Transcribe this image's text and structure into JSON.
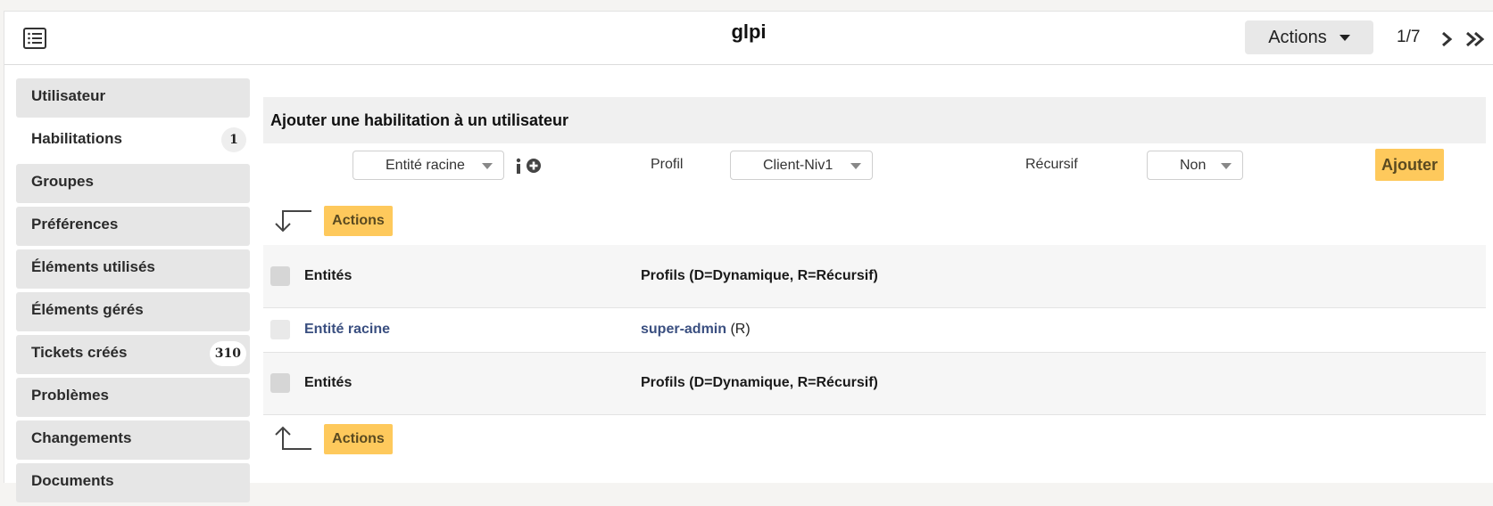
{
  "header": {
    "title": "glpi",
    "actions_label": "Actions",
    "pager": "1/7",
    "icons": {
      "list": "list-icon",
      "next": "chevron-right-icon",
      "last": "double-chevron-right-icon"
    }
  },
  "sidebar": {
    "items": [
      {
        "label": "Utilisateur",
        "badge": null
      },
      {
        "label": "Habilitations",
        "badge": "1",
        "active": true
      },
      {
        "label": "Groupes",
        "badge": null
      },
      {
        "label": "Préférences",
        "badge": null
      },
      {
        "label": "Éléments utilisés",
        "badge": null
      },
      {
        "label": "Éléments gérés",
        "badge": null
      },
      {
        "label": "Tickets créés",
        "badge": "310"
      },
      {
        "label": "Problèmes",
        "badge": null
      },
      {
        "label": "Changements",
        "badge": null
      },
      {
        "label": "Documents",
        "badge": null
      }
    ]
  },
  "form": {
    "title": "Ajouter une habilitation à un utilisateur",
    "entity_value": "Entité racine",
    "profile_label": "Profil",
    "profile_value": "Client-Niv1",
    "recursive_label": "Récursif",
    "recursive_value": "Non",
    "add_label": "Ajouter"
  },
  "massive": {
    "actions_label": "Actions"
  },
  "table": {
    "col_entities": "Entités",
    "col_profiles": "Profils (D=Dynamique, R=Récursif)",
    "rows": [
      {
        "entity": "Entité racine",
        "profile": "super-admin",
        "flags": "(R)"
      }
    ]
  },
  "colors": {
    "accent": "#fec95c",
    "link": "#3a4f80"
  }
}
